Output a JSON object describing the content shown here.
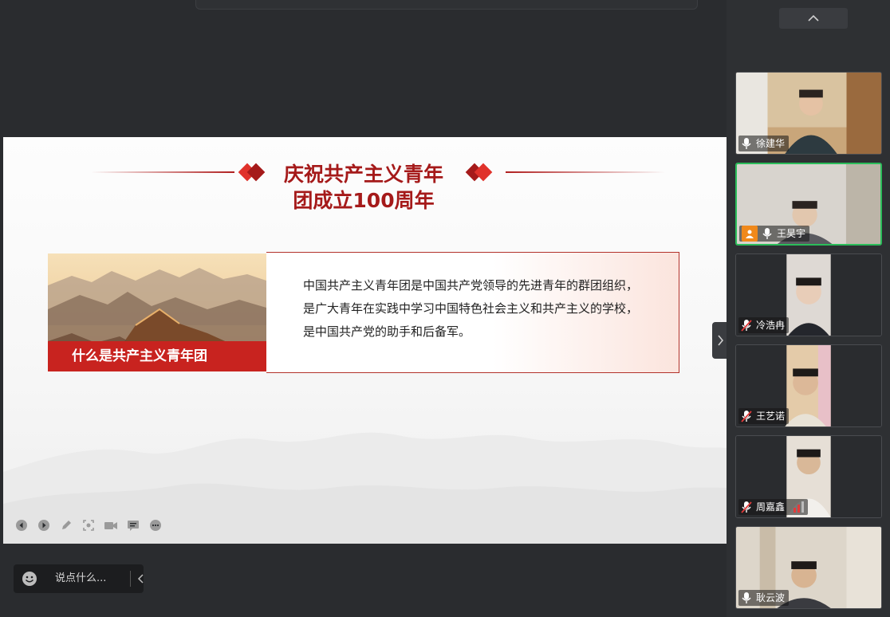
{
  "slide": {
    "title_line1": "庆祝共产主义青年",
    "title_line2": "团成立100周年",
    "image_caption": "什么是共产主义青年团",
    "body_text": "中国共产主义青年团是中国共产党领导的先进青年的群团组织，是广大青年在实践中学习中国特色社会主义和共产主义的学校，是中国共产党的助手和后备军。",
    "accent_color": "#a51a1a",
    "tools": [
      "prev-slide-icon",
      "next-slide-icon",
      "pen-icon",
      "fit-screen-icon",
      "camera-icon",
      "subtitle-icon",
      "more-icon"
    ]
  },
  "chat": {
    "placeholder": "说点什么...",
    "emoji_icon": "emoji-icon",
    "collapse_icon": "chevron-left-icon"
  },
  "participants": [
    {
      "name": "徐建华",
      "mic": "on",
      "active": false,
      "host": false
    },
    {
      "name": "王昊宇",
      "mic": "on",
      "active": true,
      "host": true
    },
    {
      "name": "冷浩冉",
      "mic": "muted",
      "active": false,
      "host": false
    },
    {
      "name": "王艺诺",
      "mic": "muted",
      "active": false,
      "host": false
    },
    {
      "name": "周嘉鑫",
      "mic": "muted",
      "active": false,
      "host": false,
      "signal": "weak"
    },
    {
      "name": "耿云波",
      "mic": "on",
      "active": false,
      "host": false
    }
  ],
  "colors": {
    "active_speaker_border": "#2bbd5a",
    "host_badge": "#f0891b",
    "muted_mic": "#e23b3b"
  }
}
